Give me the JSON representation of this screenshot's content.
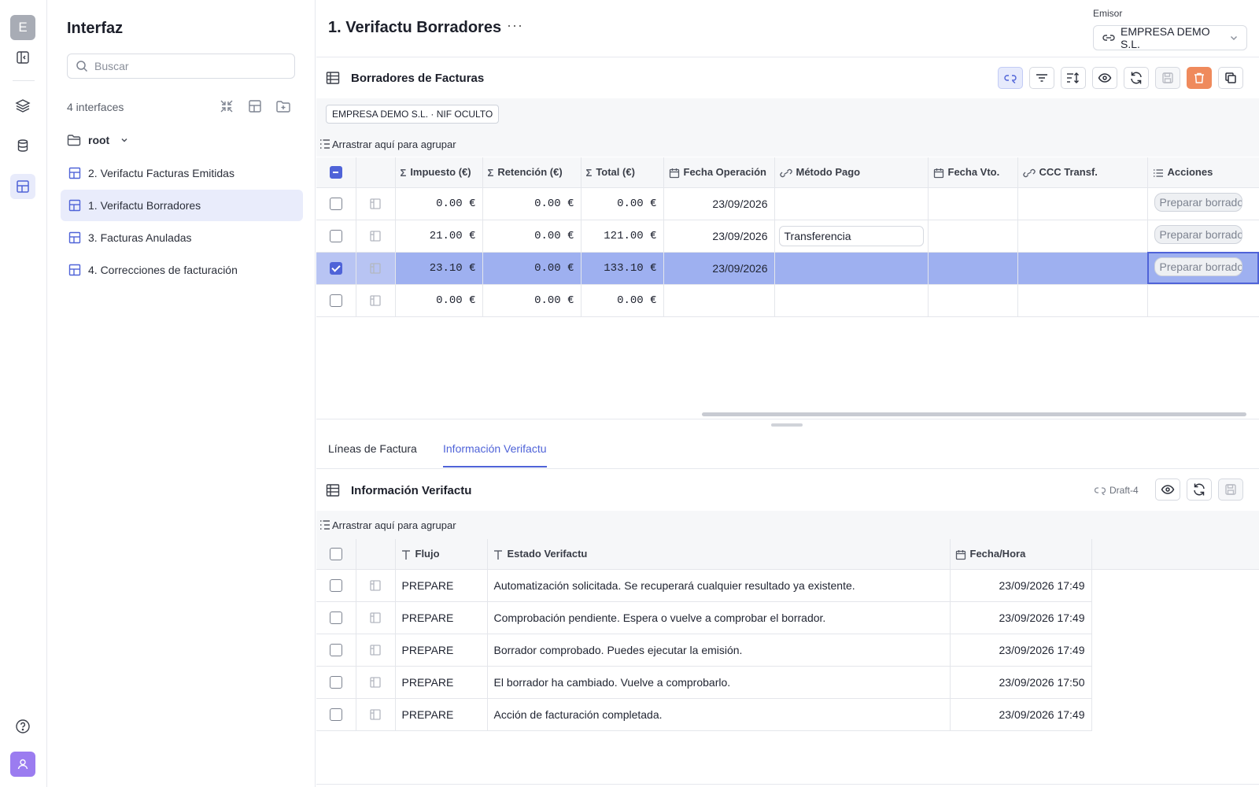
{
  "rail": {
    "workspace_initial": "E"
  },
  "sidebar": {
    "title": "Interfaz",
    "search_placeholder": "Buscar",
    "count": "4 interfaces",
    "root_label": "root",
    "items": [
      {
        "label": "2. Verifactu Facturas Emitidas",
        "active": false
      },
      {
        "label": "1. Verifactu Borradores",
        "active": true
      },
      {
        "label": "3. Facturas Anuladas",
        "active": false
      },
      {
        "label": "4. Correcciones de facturación",
        "active": false
      }
    ]
  },
  "header": {
    "title": "1. Verifactu Borradores",
    "more": "···",
    "emisor_label": "Emisor",
    "emisor_value": "EMPRESA DEMO S.L."
  },
  "drafts_section": {
    "title": "Borradores de Facturas",
    "filter_chip": "EMPRESA DEMO S.L. · NIF OCULTO",
    "group_hint": "Arrastrar aquí para agrupar",
    "columns": [
      "Impuesto (€)",
      "Retención (€)",
      "Total (€)",
      "Fecha Operación",
      "Método Pago",
      "Fecha Vto.",
      "CCC Transf.",
      "Acciones"
    ],
    "rows": [
      {
        "impuesto": "0.00 €",
        "retencion": "0.00 €",
        "total": "0.00 €",
        "fecha_op": "23/09/2026",
        "metodo": "",
        "fecha_vto": "",
        "ccc": "",
        "accion": "Preparar borrador",
        "selected": false
      },
      {
        "impuesto": "21.00 €",
        "retencion": "0.00 €",
        "total": "121.00 €",
        "fecha_op": "23/09/2026",
        "metodo": "Transferencia",
        "fecha_vto": "",
        "ccc": "",
        "accion": "Preparar borrador",
        "selected": false
      },
      {
        "impuesto": "23.10 €",
        "retencion": "0.00 €",
        "total": "133.10 €",
        "fecha_op": "23/09/2026",
        "metodo": "",
        "fecha_vto": "",
        "ccc": "",
        "accion": "Preparar borrador",
        "selected": true
      },
      {
        "impuesto": "0.00 €",
        "retencion": "0.00 €",
        "total": "0.00 €",
        "fecha_op": "",
        "metodo": "",
        "fecha_vto": "",
        "ccc": "",
        "accion": "",
        "selected": false
      }
    ]
  },
  "tabs": [
    {
      "label": "Líneas de Factura",
      "active": false
    },
    {
      "label": "Información Verifactu",
      "active": true
    }
  ],
  "info_section": {
    "title": "Información Verifactu",
    "draft_badge": "Draft-4",
    "group_hint": "Arrastrar aquí para agrupar",
    "columns": [
      "Flujo",
      "Estado Verifactu",
      "Fecha/Hora"
    ],
    "rows": [
      {
        "flujo": "PREPARE",
        "estado": "Automatización solicitada. Se recuperará cualquier resultado ya existente.",
        "fecha": "23/09/2026 17:49"
      },
      {
        "flujo": "PREPARE",
        "estado": "Comprobación pendiente. Espera o vuelve a comprobar el borrador.",
        "fecha": "23/09/2026 17:49"
      },
      {
        "flujo": "PREPARE",
        "estado": "Borrador comprobado. Puedes ejecutar la emisión.",
        "fecha": "23/09/2026 17:49"
      },
      {
        "flujo": "PREPARE",
        "estado": "El borrador ha cambiado. Vuelve a comprobarlo.",
        "fecha": "23/09/2026 17:50"
      },
      {
        "flujo": "PREPARE",
        "estado": "Acción de facturación completada.",
        "fecha": "23/09/2026 17:49"
      }
    ]
  },
  "colors": {
    "accent": "#4f63d8",
    "selected_row": "#9eb0f0",
    "danger": "#ef8a5c",
    "user_avatar": "#9b7cf0"
  }
}
